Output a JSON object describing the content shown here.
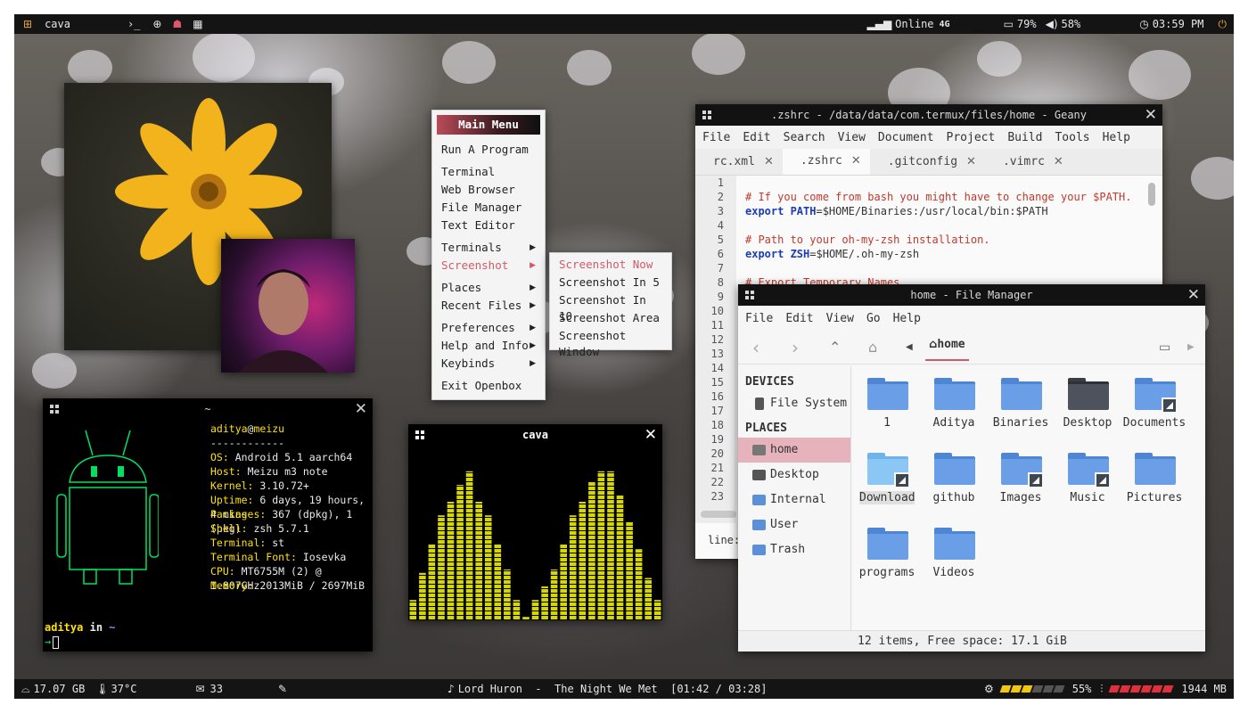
{
  "topbar": {
    "app_name": "cava",
    "network": "Online",
    "network_type": "4G",
    "battery": "79%",
    "volume": "58%",
    "clock": "03:59 PM"
  },
  "bottombar": {
    "disk": "17.07 GB",
    "temp": "37°C",
    "mail": "33",
    "now_playing": "Lord Huron  -  The Night We Met  [01:42 / 03:28]",
    "cpu": "55%",
    "memory": "1944 MB",
    "cpu_level": 0.55
  },
  "menu": {
    "header": "Main Menu",
    "items": [
      "Run A Program",
      "Terminal",
      "Web Browser",
      "File Manager",
      "Text Editor",
      "Terminals",
      "Screenshot",
      "Places",
      "Recent Files",
      "Preferences",
      "Help and Info",
      "Keybinds",
      "Exit Openbox"
    ],
    "submenu": [
      "Screenshot Now",
      "Screenshot In 5",
      "Screenshot In 10",
      "Screenshot Area",
      "Screenshot Window"
    ]
  },
  "terminal": {
    "title": "~",
    "user_host_user": "aditya",
    "user_host_at": "@",
    "user_host_host": "meizu",
    "separator": "------------",
    "info": [
      {
        "k": "OS",
        "v": "Android 5.1 aarch64"
      },
      {
        "k": "Host",
        "v": "Meizu m3 note"
      },
      {
        "k": "Kernel",
        "v": "3.10.72+"
      },
      {
        "k": "Uptime",
        "v": "6 days, 19 hours, 4 mins"
      },
      {
        "k": "Packages",
        "v": "367 (dpkg), 1 (pkg)"
      },
      {
        "k": "Shell",
        "v": "zsh 5.7.1"
      },
      {
        "k": "Terminal",
        "v": "st"
      },
      {
        "k": "Terminal Font",
        "v": "Iosevka"
      },
      {
        "k": "CPU",
        "v": "MT6755M (2) @ 1.807GHz"
      },
      {
        "k": "Memory",
        "v": "2013MiB / 2697MiB"
      }
    ],
    "prompt_user": "aditya",
    "prompt_in": "in",
    "prompt_dir": "~",
    "prompt_arrow": "→"
  },
  "cava": {
    "title": "cava",
    "bar_color": "#d7d700",
    "levels": [
      0.12,
      0.28,
      0.45,
      0.62,
      0.7,
      0.8,
      0.88,
      0.7,
      0.62,
      0.45,
      0.3,
      0.12,
      0.02,
      0.12,
      0.2,
      0.3,
      0.45,
      0.62,
      0.7,
      0.82,
      0.88,
      0.88,
      0.74,
      0.58,
      0.42,
      0.25,
      0.12
    ]
  },
  "geany": {
    "title": ".zshrc - /data/data/com.termux/files/home - Geany",
    "menu": [
      "File",
      "Edit",
      "Search",
      "View",
      "Document",
      "Project",
      "Build",
      "Tools",
      "Help"
    ],
    "tabs": [
      "rc.xml",
      ".zshrc",
      ".gitconfig",
      ".vimrc"
    ],
    "line_numbers": [
      "1",
      "2",
      "3",
      "4",
      "5",
      "6",
      "7",
      "8",
      "9",
      "10",
      "11",
      "12",
      "13",
      "14",
      "15",
      "16",
      "17",
      "18",
      "19",
      "20",
      "21",
      "22",
      "23"
    ],
    "code": {
      "l1": "# If you come from bash you might have to change your $PATH.",
      "l2_kw": "export",
      "l2_var": " PATH",
      "l2_rest": "=$HOME/Binaries:/usr/local/bin:$PATH",
      "l4": "# Path to your oh-my-zsh installation.",
      "l5_kw": "export",
      "l5_var": " ZSH",
      "l5_rest": "=$HOME/.oh-my-zsh",
      "l7": "# Export Temporary Names"
    },
    "status": "line:"
  },
  "fm": {
    "title": "home - File Manager",
    "menu": [
      "File",
      "Edit",
      "View",
      "Go",
      "Help"
    ],
    "path": "home",
    "devices_label": "DEVICES",
    "devices": [
      "File System"
    ],
    "places_label": "PLACES",
    "places": [
      "home",
      "Desktop",
      "Internal",
      "User",
      "Trash"
    ],
    "items": [
      "1",
      "Aditya",
      "Binaries",
      "Desktop",
      "Documents",
      "Download",
      "github",
      "Images",
      "Music",
      "Pictures",
      "programs",
      "Videos"
    ],
    "status": "12 items, Free space: 17.1 GiB"
  }
}
